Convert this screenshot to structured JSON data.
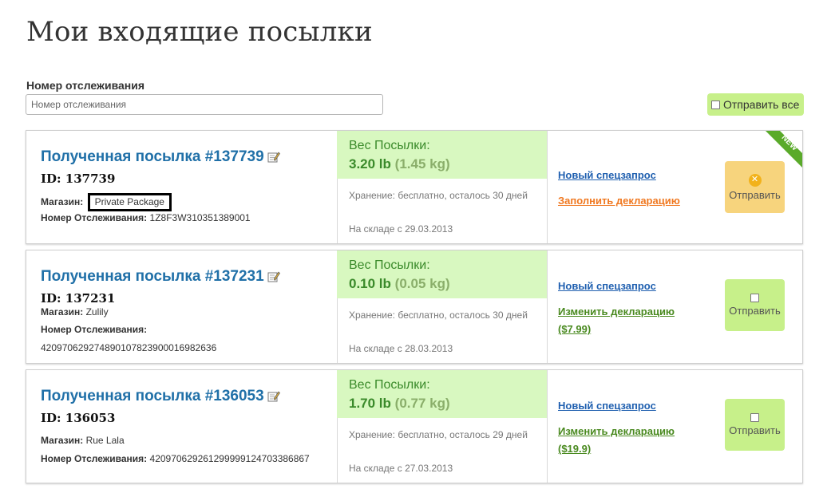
{
  "page": {
    "title": "Мои входящие посылки",
    "tracking_label": "Номер отслеживания",
    "tracking_placeholder": "Номер отслеживания",
    "send_all_label": "Отправить все"
  },
  "packages": [
    {
      "title": "Полученная посылка #137739",
      "id_line": "ID: 137739",
      "store_label": "Магазин:",
      "store_value": "Private Package",
      "tracking_label": "Номер Отслеживания:",
      "tracking_value": "1Z8F3W310351389001",
      "weight_label": "Вес Посылки:",
      "weight_lb": "3.20 lb",
      "weight_kg": "(1.45 kg)",
      "storage": "Хранение: бесплатно, осталось 30 дней",
      "in_stock": "На складе с 29.03.2013",
      "link1": "Новый спецзапрос",
      "link2": "Заполнить декларацию",
      "link2_color": "#f07820",
      "send_label": "Отправить",
      "ribbon": "NEW"
    },
    {
      "title": "Полученная посылка #137231",
      "id_line": "ID: 137231",
      "store_label": "Магазин:",
      "store_value": "Zulily",
      "tracking_label": "Номер Отслеживания:",
      "tracking_value": "420970629274890107823900016982636",
      "weight_label": "Вес Посылки:",
      "weight_lb": "0.10 lb",
      "weight_kg": "(0.05 kg)",
      "storage": "Хранение: бесплатно, осталось 30 дней",
      "in_stock": "На складе с 28.03.2013",
      "link1": "Новый спецзапрос",
      "link2": "Изменить декларацию",
      "link2_price": "($7.99)",
      "link2_color": "#4a8a20",
      "send_label": "Отправить"
    },
    {
      "title": "Полученная посылка #136053",
      "id_line": "ID: 136053",
      "store_label": "Магазин:",
      "store_value": "Rue Lala",
      "tracking_label": "Номер Отслеживания:",
      "tracking_value": "420970629261299999124703386867",
      "weight_label": "Вес Посылки:",
      "weight_lb": "1.70 lb",
      "weight_kg": "(0.77 kg)",
      "storage": "Хранение: бесплатно, осталось 29 дней",
      "in_stock": "На складе с 27.03.2013",
      "link1": "Новый спецзапрос",
      "link2": "Изменить декларацию",
      "link2_price": "($19.9)",
      "link2_color": "#4a8a20",
      "send_label": "Отправить"
    }
  ],
  "colors": {
    "title_blue": "#2070a8",
    "weight_green": "#3a8a2a",
    "weight_bg": "#d8f8c0",
    "button_green": "#c7f08a",
    "button_orange": "#f7d47d",
    "ribbon_green": "#5aaa2a"
  },
  "icons": [
    "edit-icon",
    "x-circle-icon",
    "checkbox"
  ]
}
